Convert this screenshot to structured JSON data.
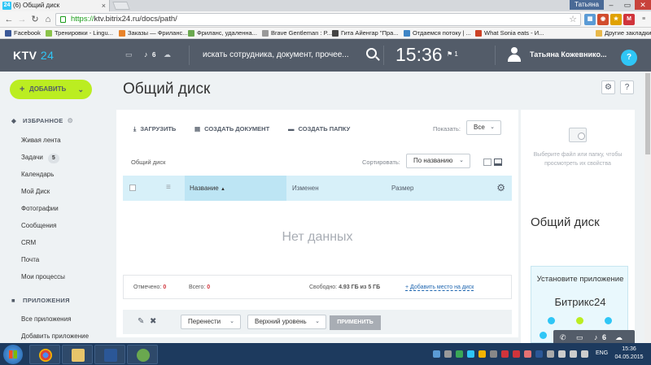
{
  "browser": {
    "tab_title": "(6) Общий диск",
    "favicon_text": "24",
    "user_label": "Татьяна",
    "url_scheme": "https://",
    "url_rest": "ktv.bitrix24.ru/docs/path/",
    "bookmarks": [
      "Facebook",
      "Тренировки - Lingu...",
      "Заказы — Фриланс...",
      "Фриланс, удаленна...",
      "Brave Gentleman : P...",
      "Гита Айенгар \"Пра...",
      "Отдаемся потоку | ...",
      "What Sonia eats - И...",
      "Другие закладки"
    ]
  },
  "header": {
    "logo_text": "KTV",
    "logo_num": "24",
    "notifications_count": "6",
    "search_placeholder": "искать сотрудника, документ, прочее...",
    "time": "15:36",
    "flag_count": "1",
    "user_name": "Татьяна Кожевнико...",
    "help_label": "?"
  },
  "sidebar": {
    "add_button": "ДОБАВИТЬ",
    "favorites_heading": "ИЗБРАННОЕ",
    "favorites": [
      "Живая лента",
      "Задачи",
      "Календарь",
      "Мой Диск",
      "Фотографии",
      "Сообщения",
      "CRM",
      "Почта",
      "Мои процессы"
    ],
    "tasks_badge": "5",
    "apps_heading": "ПРИЛОЖЕНИЯ",
    "apps": [
      "Все приложения",
      "Добавить приложение"
    ]
  },
  "page": {
    "title": "Общий диск"
  },
  "toolbar": {
    "upload": "ЗАГРУЗИТЬ",
    "create_doc": "СОЗДАТЬ ДОКУМЕНТ",
    "create_folder": "СОЗДАТЬ ПАПКУ",
    "show_label": "Показать:",
    "show_value": "Все"
  },
  "grid": {
    "breadcrumb": "Общий диск",
    "sort_label": "Сортировать:",
    "sort_value": "По названию",
    "columns": [
      "Название",
      "Изменен",
      "Размер"
    ],
    "empty_text": "Нет данных"
  },
  "footer": {
    "selected_label": "Отмечено:",
    "selected_value": "0",
    "total_label": "Всего:",
    "total_value": "0",
    "free_label": "Свободно:",
    "free_value": "4.93 ГБ из 5 ГБ",
    "add_space_link": "+ Добавить место на диск"
  },
  "actions": {
    "move_value": "Перенести",
    "level_value": "Верхний уровень",
    "apply_button": "ПРИМЕНИТЬ"
  },
  "right_panel": {
    "hint": "Выберите файл или папку, чтобы просмотреть их свойства",
    "title": "Общий диск",
    "promo_line1": "Установите приложение",
    "promo_line2": "Битрикс24"
  },
  "float_bar": {
    "count": "6"
  },
  "taskbar": {
    "language": "ENG",
    "time": "15:36",
    "date": "04.05.2015"
  }
}
